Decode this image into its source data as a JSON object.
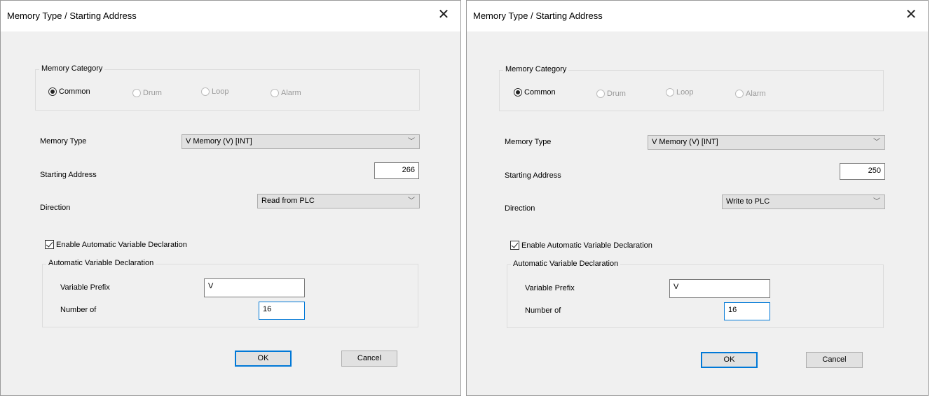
{
  "dialogs": [
    {
      "title": "Memory Type / Starting Address",
      "category": {
        "legend": "Memory Category",
        "options": [
          "Common",
          "Drum",
          "Loop",
          "Alarm"
        ],
        "selected": "Common"
      },
      "memory_type_label": "Memory Type",
      "memory_type_value": "V Memory (V) [INT]",
      "starting_address_label": "Starting Address",
      "starting_address_value": "266",
      "direction_label": "Direction",
      "direction_value": "Read from PLC",
      "enable_auto_label": "Enable Automatic Variable Declaration",
      "enable_auto_checked": true,
      "auto_group_legend": "Automatic Variable Declaration",
      "prefix_label": "Variable Prefix",
      "prefix_value": "V",
      "number_label": "Number of",
      "number_value": "16",
      "ok_label": "OK",
      "cancel_label": "Cancel"
    },
    {
      "title": "Memory Type / Starting Address",
      "category": {
        "legend": "Memory Category",
        "options": [
          "Common",
          "Drum",
          "Loop",
          "Alarm"
        ],
        "selected": "Common"
      },
      "memory_type_label": "Memory Type",
      "memory_type_value": "V Memory (V) [INT]",
      "starting_address_label": "Starting Address",
      "starting_address_value": "250",
      "direction_label": "Direction",
      "direction_value": "Write to PLC",
      "enable_auto_label": "Enable Automatic Variable Declaration",
      "enable_auto_checked": true,
      "auto_group_legend": "Automatic Variable Declaration",
      "prefix_label": "Variable Prefix",
      "prefix_value": "V",
      "number_label": "Number of",
      "number_value": "16",
      "ok_label": "OK",
      "cancel_label": "Cancel"
    }
  ],
  "icons": {
    "close": "close-icon",
    "dropdown": "chevron-down-icon",
    "check": "checkmark-icon"
  }
}
